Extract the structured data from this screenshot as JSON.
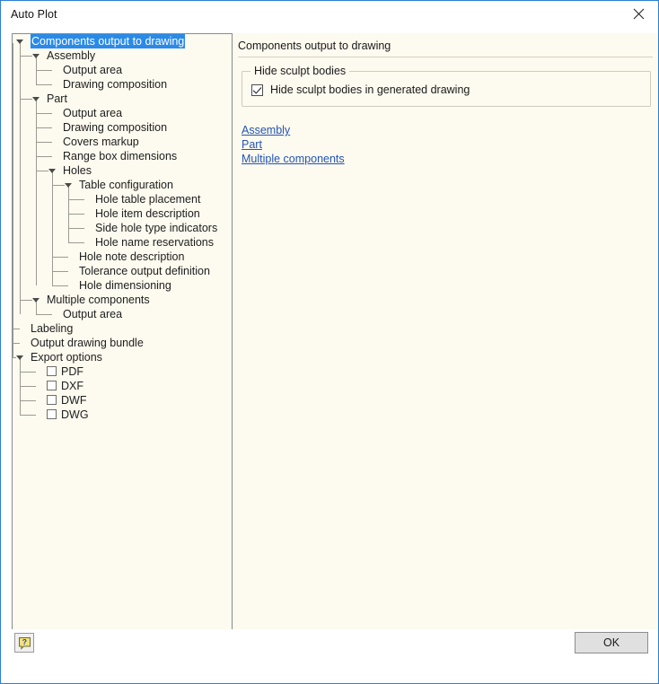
{
  "window": {
    "title": "Auto Plot",
    "close_icon": "close-icon"
  },
  "tree": {
    "selected": "Components output to drawing",
    "items": [
      {
        "label": "Components output to drawing",
        "depth": 0,
        "expander": true,
        "selected": true,
        "checkbox": false,
        "last": false
      },
      {
        "label": "Assembly",
        "depth": 1,
        "expander": true,
        "selected": false,
        "checkbox": false,
        "last": false
      },
      {
        "label": "Output area",
        "depth": 2,
        "expander": false,
        "selected": false,
        "checkbox": false,
        "last": false
      },
      {
        "label": "Drawing composition",
        "depth": 2,
        "expander": false,
        "selected": false,
        "checkbox": false,
        "last": true
      },
      {
        "label": "Part",
        "depth": 1,
        "expander": true,
        "selected": false,
        "checkbox": false,
        "last": false
      },
      {
        "label": "Output area",
        "depth": 2,
        "expander": false,
        "selected": false,
        "checkbox": false,
        "last": false
      },
      {
        "label": "Drawing composition",
        "depth": 2,
        "expander": false,
        "selected": false,
        "checkbox": false,
        "last": false
      },
      {
        "label": "Covers markup",
        "depth": 2,
        "expander": false,
        "selected": false,
        "checkbox": false,
        "last": false
      },
      {
        "label": "Range box dimensions",
        "depth": 2,
        "expander": false,
        "selected": false,
        "checkbox": false,
        "last": false
      },
      {
        "label": "Holes",
        "depth": 2,
        "expander": true,
        "selected": false,
        "checkbox": false,
        "last": false
      },
      {
        "label": "Table configuration",
        "depth": 3,
        "expander": true,
        "selected": false,
        "checkbox": false,
        "last": false
      },
      {
        "label": "Hole table placement",
        "depth": 4,
        "expander": false,
        "selected": false,
        "checkbox": false,
        "last": false
      },
      {
        "label": "Hole item description",
        "depth": 4,
        "expander": false,
        "selected": false,
        "checkbox": false,
        "last": false
      },
      {
        "label": "Side hole type indicators",
        "depth": 4,
        "expander": false,
        "selected": false,
        "checkbox": false,
        "last": false
      },
      {
        "label": "Hole name reservations",
        "depth": 4,
        "expander": false,
        "selected": false,
        "checkbox": false,
        "last": true
      },
      {
        "label": "Hole note description",
        "depth": 3,
        "expander": false,
        "selected": false,
        "checkbox": false,
        "last": false
      },
      {
        "label": "Tolerance output definition",
        "depth": 3,
        "expander": false,
        "selected": false,
        "checkbox": false,
        "last": false
      },
      {
        "label": "Hole dimensioning",
        "depth": 3,
        "expander": false,
        "selected": false,
        "checkbox": false,
        "last": true
      },
      {
        "label": "Multiple components",
        "depth": 1,
        "expander": true,
        "selected": false,
        "checkbox": false,
        "last": true
      },
      {
        "label": "Output area",
        "depth": 2,
        "expander": false,
        "selected": false,
        "checkbox": false,
        "last": true
      },
      {
        "label": "Labeling",
        "depth": 0,
        "expander": false,
        "selected": false,
        "checkbox": false,
        "last": false
      },
      {
        "label": "Output drawing bundle",
        "depth": 0,
        "expander": false,
        "selected": false,
        "checkbox": false,
        "last": false
      },
      {
        "label": "Export options",
        "depth": 0,
        "expander": true,
        "selected": false,
        "checkbox": false,
        "last": true
      },
      {
        "label": "PDF",
        "depth": 1,
        "expander": false,
        "selected": false,
        "checkbox": true,
        "checked": false,
        "last": false
      },
      {
        "label": "DXF",
        "depth": 1,
        "expander": false,
        "selected": false,
        "checkbox": true,
        "checked": false,
        "last": false
      },
      {
        "label": "DWF",
        "depth": 1,
        "expander": false,
        "selected": false,
        "checkbox": true,
        "checked": false,
        "last": false
      },
      {
        "label": "DWG",
        "depth": 1,
        "expander": false,
        "selected": false,
        "checkbox": true,
        "checked": false,
        "last": true
      }
    ]
  },
  "content": {
    "header": "Components output to drawing",
    "groupbox": {
      "title": "Hide sculpt bodies",
      "checkbox_label": "Hide sculpt bodies in generated drawing",
      "checked": true
    },
    "links": [
      {
        "label": "Assembly"
      },
      {
        "label": "Part"
      },
      {
        "label": "Multiple components"
      }
    ]
  },
  "footer": {
    "help_icon": "help-icon",
    "ok_label": "OK"
  },
  "colors": {
    "accent": "#2a7fd4",
    "selection": "#2a8ae8",
    "panel_bg": "#fdfaef",
    "link": "#2354b5"
  }
}
